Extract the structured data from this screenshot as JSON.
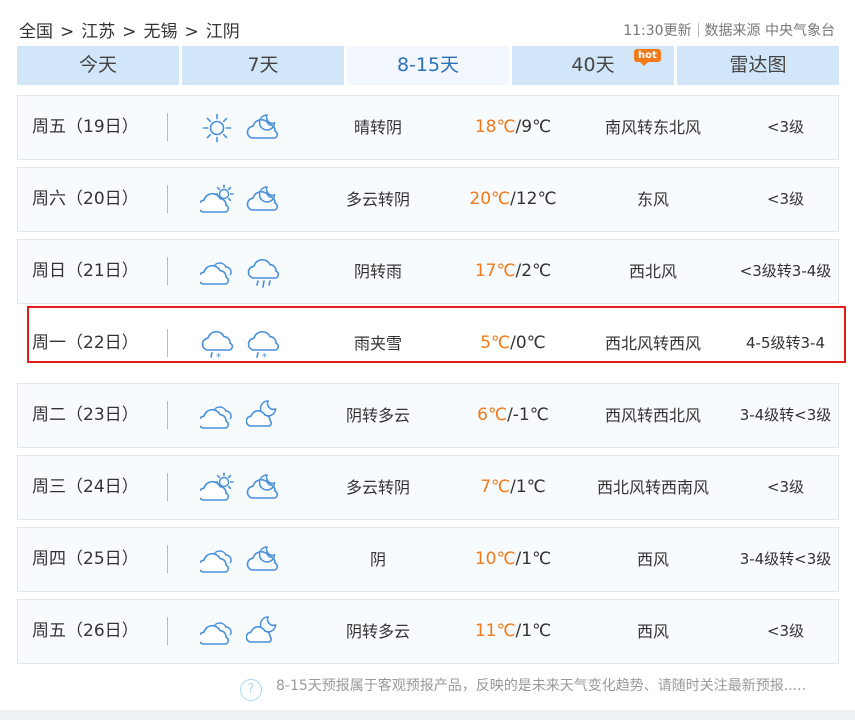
{
  "breadcrumb": [
    "全国",
    "江苏",
    "无锡",
    "江阴"
  ],
  "breadcrumb_sep": ">",
  "updated": "11:30更新",
  "source": "数据来源 中央气象台",
  "tabs": [
    {
      "label": "今天"
    },
    {
      "label": "7天"
    },
    {
      "label": "8-15天",
      "active": true
    },
    {
      "label": "40天",
      "badge": "hot"
    },
    {
      "label": "雷达图"
    }
  ],
  "days": [
    {
      "day": "周五（19日）",
      "icon1": "sun-icon",
      "icon2": "cloudy-night-icon",
      "desc": "晴转阴",
      "hi": "18℃",
      "lo": "/9℃",
      "wind": "南风转东北风",
      "level": "<3级"
    },
    {
      "day": "周六（20日）",
      "icon1": "partly-cloudy-icon",
      "icon2": "cloudy-night-icon",
      "desc": "多云转阴",
      "hi": "20℃",
      "lo": "/12℃",
      "wind": "东风",
      "level": "<3级"
    },
    {
      "day": "周日（21日）",
      "icon1": "overcast-icon",
      "icon2": "rain-icon",
      "desc": "阴转雨",
      "hi": "17℃",
      "lo": "/2℃",
      "wind": "西北风",
      "level": "<3级转3-4级"
    },
    {
      "day": "周一（22日）",
      "icon1": "sleet-icon",
      "icon2": "sleet-icon",
      "desc": "雨夹雪",
      "hi": "5℃",
      "lo": "/0℃",
      "wind": "西北风转西风",
      "level": "4-5级转3-4",
      "highlight": true
    },
    {
      "day": "周二（23日）",
      "icon1": "overcast-icon",
      "icon2": "moon-cloud-icon",
      "desc": "阴转多云",
      "hi": "6℃",
      "lo": "/-1℃",
      "wind": "西风转西北风",
      "level": "3-4级转<3级"
    },
    {
      "day": "周三（24日）",
      "icon1": "partly-cloudy-icon",
      "icon2": "cloudy-night-icon",
      "desc": "多云转阴",
      "hi": "7℃",
      "lo": "/1℃",
      "wind": "西北风转西南风",
      "level": "<3级"
    },
    {
      "day": "周四（25日）",
      "icon1": "overcast-icon",
      "icon2": "cloudy-night-icon",
      "desc": "阴",
      "hi": "10℃",
      "lo": "/1℃",
      "wind": "西风",
      "level": "3-4级转<3级"
    },
    {
      "day": "周五（26日）",
      "icon1": "overcast-icon",
      "icon2": "moon-cloud-icon",
      "desc": "阴转多云",
      "hi": "11℃",
      "lo": "/1℃",
      "wind": "西风",
      "level": "<3级"
    }
  ],
  "footer_note": "8-15天预报属于客观预报产品，反映的是未来天气变化趋势、请随时关注最新预报.....",
  "colors": {
    "accent": "#2f6fb8",
    "temp_high": "#f07a1a",
    "icon": "#4a90d9",
    "highlight_border": "#e31c1c"
  }
}
